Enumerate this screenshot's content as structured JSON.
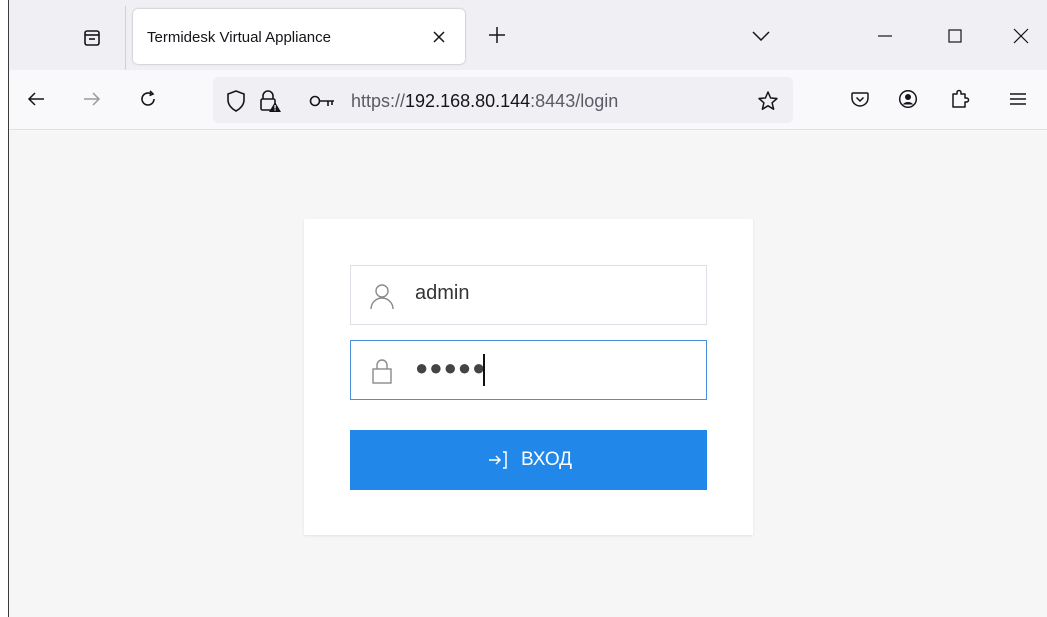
{
  "browser": {
    "tab": {
      "title": "Termidesk Virtual Appliance"
    },
    "url": {
      "scheme": "https://",
      "host": "192.168.80.144",
      "rest": ":8443/login"
    }
  },
  "login": {
    "username_value": "admin",
    "password_masked": "●●●●●",
    "submit_label": "ВХОД"
  },
  "colors": {
    "accent": "#2188ea",
    "focus_border": "#4a90d9"
  }
}
